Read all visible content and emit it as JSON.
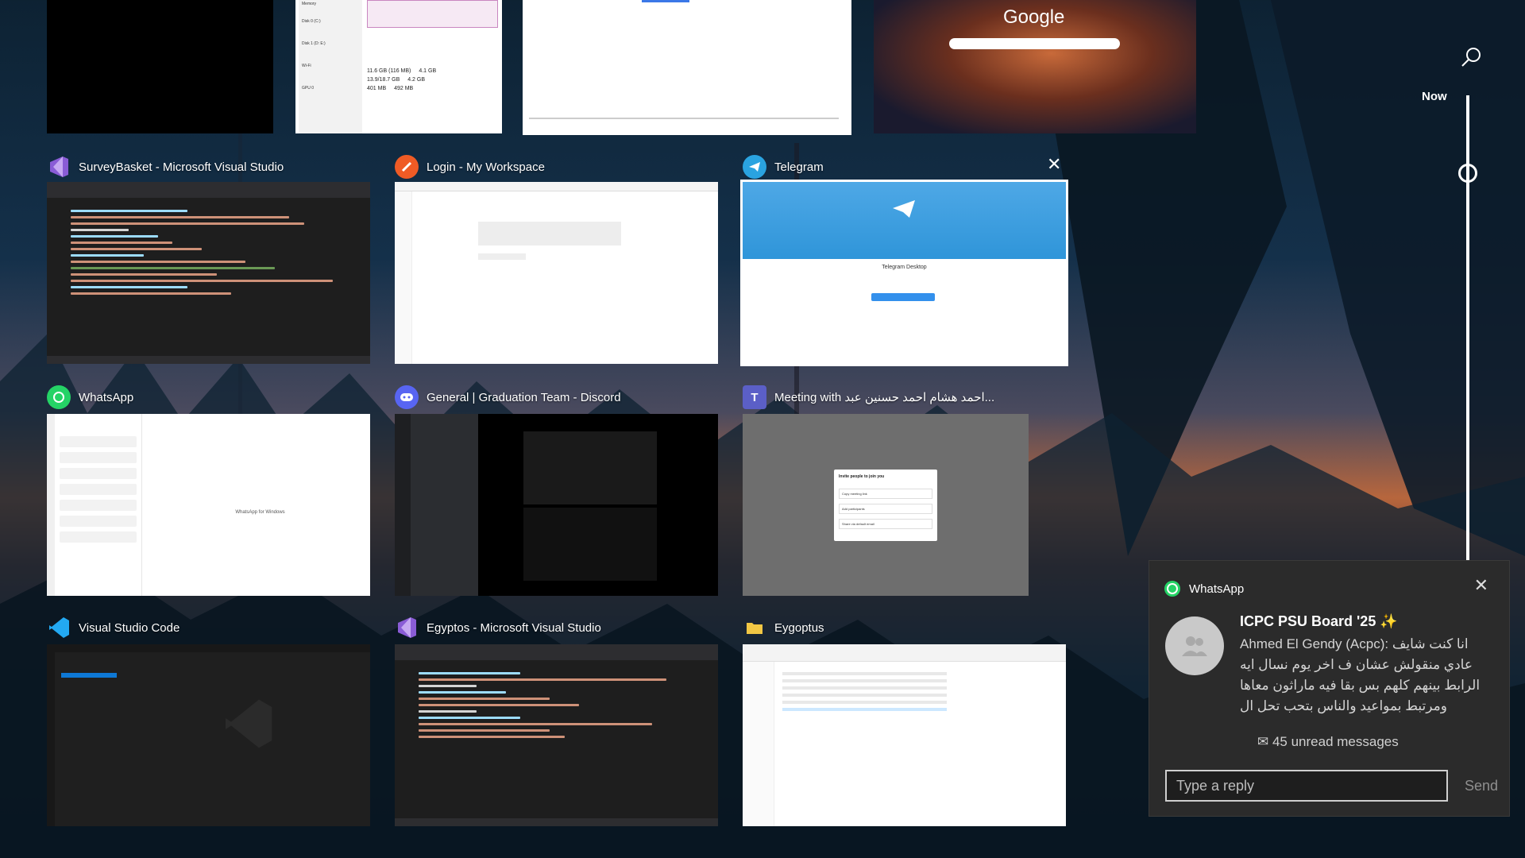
{
  "timeline": {
    "now_label": "Now"
  },
  "top_row": [
    {
      "id": "black-window"
    },
    {
      "id": "task-manager",
      "lines": [
        "Memory",
        "Disk 0 (C:)",
        "Disk 1 (D: E:)",
        "Wi-Fi",
        "GPU 0",
        "11.6 GB (116 MB)",
        "4.1 GB",
        "13.9/18.7 GB",
        "4.2 GB",
        "401 MB",
        "492 MB"
      ]
    },
    {
      "id": "white-window"
    },
    {
      "id": "browser",
      "google_label": "Google"
    }
  ],
  "windows": [
    {
      "title": "SurveyBasket - Microsoft Visual Studio",
      "icon": "visual-studio-icon"
    },
    {
      "title": "Login - My Workspace",
      "icon": "postman-icon"
    },
    {
      "title": "Telegram",
      "icon": "telegram-icon",
      "thumb_title": "Telegram Desktop"
    },
    {
      "title": "WhatsApp",
      "icon": "whatsapp-icon",
      "thumb_title": "WhatsApp for Windows"
    },
    {
      "title": "General | Graduation Team - Discord",
      "icon": "discord-icon"
    },
    {
      "title": "Meeting with احمد هشام احمد حسنين عبد...",
      "icon": "teams-icon",
      "thumb_title": "Invite people to join you",
      "thumb_items": [
        "Copy meeting link",
        "Add participants",
        "Share via default email"
      ]
    },
    {
      "title": "Visual Studio Code",
      "icon": "vscode-icon"
    },
    {
      "title": "Egyptos - Microsoft Visual Studio",
      "icon": "visual-studio-icon"
    },
    {
      "title": "Eygoptus",
      "icon": "folder-icon"
    }
  ],
  "notification": {
    "app_name": "WhatsApp",
    "title": "ICPC PSU Board '25 ✨",
    "sender": "Ahmed El Gendy (Acpc):",
    "message": "انا كنت شايف عادي منقولش عشان ف اخر يوم نسال ايه الرابط بينهم كلهم بس بقا فيه ماراثون معاها ومرتبط بمواعيد والناس بتحب تحل ال",
    "unread": "✉ 45 unread messages",
    "reply_placeholder": "Type a reply",
    "send_label": "Send"
  }
}
